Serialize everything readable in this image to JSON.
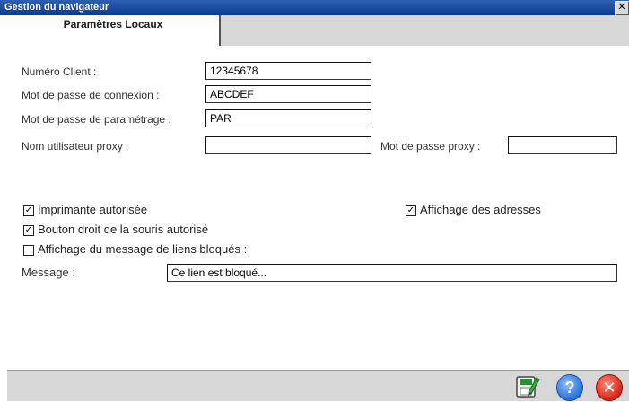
{
  "window": {
    "title": "Gestion du navigateur",
    "close_label": "✕"
  },
  "tabs": [
    {
      "label": "Paramètres Locaux"
    }
  ],
  "form": {
    "client_number": {
      "label": "Numéro Client :",
      "value": "12345678"
    },
    "login_password": {
      "label": "Mot de passe de connexion :",
      "value": "ABCDEF"
    },
    "settings_password": {
      "label": "Mot de passe de paramétrage :",
      "value": "PAR"
    },
    "proxy_user": {
      "label": "Nom utilisateur proxy :",
      "value": ""
    },
    "proxy_password": {
      "label": "Mot de passe proxy :",
      "value": ""
    }
  },
  "checkboxes": {
    "printer": {
      "label": "Imprimante autorisée",
      "checked": true
    },
    "show_addresses": {
      "label": "Affichage des adresses",
      "checked": true
    },
    "right_click": {
      "label": "Bouton droit de la souris autorisé",
      "checked": true
    },
    "blocked_message": {
      "label": "Affichage du message de liens bloqués :",
      "checked": false
    }
  },
  "message": {
    "label": "Message :",
    "value": "Ce lien est bloqué..."
  },
  "buttons": {
    "save_icon": "save-edit-icon",
    "help_icon": "help-icon",
    "cancel_icon": "cancel-icon"
  },
  "colors": {
    "titlebar": "#0d3a8e",
    "panel": "#d7d7d7",
    "help": "#2b6fd8",
    "cancel": "#d62418"
  }
}
